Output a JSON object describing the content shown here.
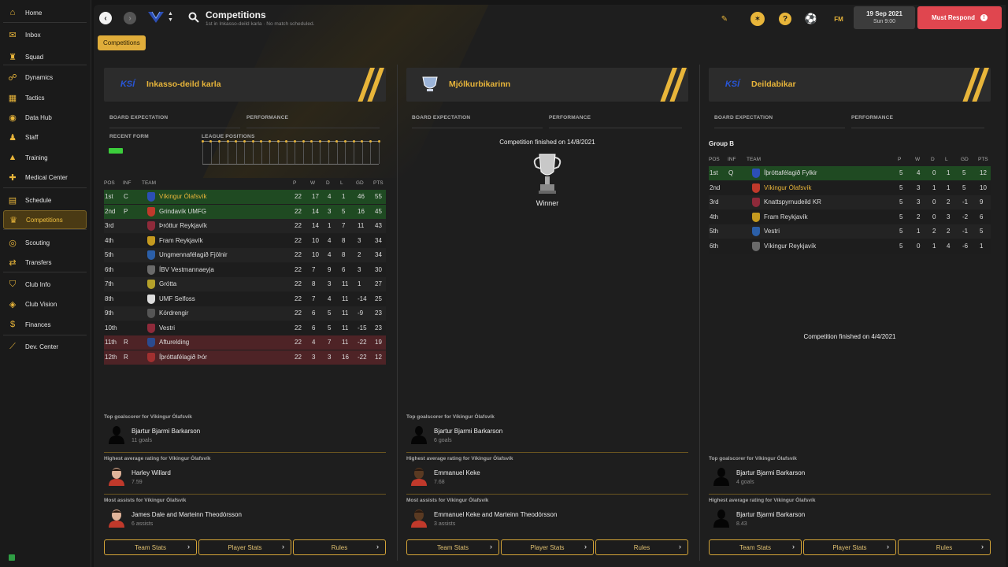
{
  "sidebar": {
    "items": [
      {
        "label": "Home",
        "icon": "home-icon",
        "glyph": "⌂"
      },
      {
        "label": "Inbox",
        "icon": "inbox-icon",
        "glyph": "✉"
      },
      {
        "label": "Squad",
        "icon": "shirt-icon",
        "glyph": "♜"
      },
      {
        "label": "Dynamics",
        "icon": "dynamics-icon",
        "glyph": "☍"
      },
      {
        "label": "Tactics",
        "icon": "tactics-icon",
        "glyph": "▦"
      },
      {
        "label": "Data Hub",
        "icon": "data-hub-icon",
        "glyph": "◉"
      },
      {
        "label": "Staff",
        "icon": "staff-icon",
        "glyph": "♟"
      },
      {
        "label": "Training",
        "icon": "training-icon",
        "glyph": "▲"
      },
      {
        "label": "Medical Center",
        "icon": "medical-icon",
        "glyph": "✚"
      },
      {
        "label": "Schedule",
        "icon": "schedule-icon",
        "glyph": "▤"
      },
      {
        "label": "Competitions",
        "icon": "trophy-icon",
        "glyph": "♛"
      },
      {
        "label": "Scouting",
        "icon": "scouting-icon",
        "glyph": "◎"
      },
      {
        "label": "Transfers",
        "icon": "transfers-icon",
        "glyph": "⇄"
      },
      {
        "label": "Club Info",
        "icon": "club-info-icon",
        "glyph": "⛉"
      },
      {
        "label": "Club Vision",
        "icon": "club-vision-icon",
        "glyph": "◈"
      },
      {
        "label": "Finances",
        "icon": "finances-icon",
        "glyph": "$"
      },
      {
        "label": "Dev. Center",
        "icon": "dev-center-icon",
        "glyph": "⟋"
      }
    ],
    "active_index": 10
  },
  "header": {
    "title": "Competitions",
    "subtitle": "1st in Inkasso-deild karla · No match scheduled.",
    "date": "19 Sep 2021",
    "time": "Sun 9:00",
    "fm_label": "FM",
    "must_respond": "Must Respond",
    "tag": "Competitions"
  },
  "panels": [
    {
      "name": "Inkasso-deild karla",
      "logo": "KSÍ",
      "board_expectation_label": "BOARD EXPECTATION",
      "performance_label": "PERFORMANCE",
      "recent_form_label": "RECENT FORM",
      "league_positions_label": "LEAGUE POSITIONS",
      "columns": [
        "POS",
        "INF",
        "TEAM",
        "P",
        "W",
        "D",
        "L",
        "GD",
        "PTS"
      ],
      "rows": [
        {
          "pos": "1st",
          "inf": "C",
          "team": "Víkingur Ólafsvík",
          "p": "22",
          "w": "17",
          "d": "4",
          "l": "1",
          "gd": "46",
          "pts": "55",
          "zone": "promo",
          "highlight": true
        },
        {
          "pos": "2nd",
          "inf": "P",
          "team": "Grindavík UMFG",
          "p": "22",
          "w": "14",
          "d": "3",
          "l": "5",
          "gd": "16",
          "pts": "45",
          "zone": "promo"
        },
        {
          "pos": "3rd",
          "inf": "",
          "team": "Þróttur Reykjavík",
          "p": "22",
          "w": "14",
          "d": "1",
          "l": "7",
          "gd": "11",
          "pts": "43"
        },
        {
          "pos": "4th",
          "inf": "",
          "team": "Fram Reykjavík",
          "p": "22",
          "w": "10",
          "d": "4",
          "l": "8",
          "gd": "3",
          "pts": "34"
        },
        {
          "pos": "5th",
          "inf": "",
          "team": "Ungmennafélagið Fjölnir",
          "p": "22",
          "w": "10",
          "d": "4",
          "l": "8",
          "gd": "2",
          "pts": "34"
        },
        {
          "pos": "6th",
          "inf": "",
          "team": "ÍBV Vestmannaeyja",
          "p": "22",
          "w": "7",
          "d": "9",
          "l": "6",
          "gd": "3",
          "pts": "30"
        },
        {
          "pos": "7th",
          "inf": "",
          "team": "Grótta",
          "p": "22",
          "w": "8",
          "d": "3",
          "l": "11",
          "gd": "1",
          "pts": "27"
        },
        {
          "pos": "8th",
          "inf": "",
          "team": "UMF Selfoss",
          "p": "22",
          "w": "7",
          "d": "4",
          "l": "11",
          "gd": "-14",
          "pts": "25"
        },
        {
          "pos": "9th",
          "inf": "",
          "team": "Kórdrengir",
          "p": "22",
          "w": "6",
          "d": "5",
          "l": "11",
          "gd": "-9",
          "pts": "23"
        },
        {
          "pos": "10th",
          "inf": "",
          "team": "Vestri",
          "p": "22",
          "w": "6",
          "d": "5",
          "l": "11",
          "gd": "-15",
          "pts": "23"
        },
        {
          "pos": "11th",
          "inf": "R",
          "team": "Afturelding",
          "p": "22",
          "w": "4",
          "d": "7",
          "l": "11",
          "gd": "-22",
          "pts": "19",
          "zone": "releg"
        },
        {
          "pos": "12th",
          "inf": "R",
          "team": "Íþróttafélagið Þór",
          "p": "22",
          "w": "3",
          "d": "3",
          "l": "16",
          "gd": "-22",
          "pts": "12",
          "zone": "releg"
        }
      ],
      "stats": [
        {
          "heading": "Top goalscorer for Víkingur Ólafsvík",
          "name": "Bjartur Bjarmi Barkarson",
          "value": "11 goals",
          "avatar": "silhouette"
        },
        {
          "heading": "Highest average rating for Víkingur Ólafsvík",
          "name": "Harley Willard",
          "value": "7.59",
          "avatar": "face-light"
        },
        {
          "heading": "Most assists for Víkingur Ólafsvík",
          "name": "James Dale and Marteinn Theodórsson",
          "value": "6 assists",
          "avatar": "face-light"
        }
      ],
      "buttons": [
        "Team Stats",
        "Player Stats",
        "Rules"
      ]
    },
    {
      "name": "Mjólkurbikarinn",
      "logo": "cup",
      "board_expectation_label": "BOARD EXPECTATION",
      "performance_label": "PERFORMANCE",
      "finished_text": "Competition finished on 14/8/2021",
      "winner_label": "Winner",
      "stats": [
        {
          "heading": "Top goalscorer for Víkingur Ólafsvík",
          "name": "Bjartur Bjarmi Barkarson",
          "value": "6 goals",
          "avatar": "silhouette"
        },
        {
          "heading": "Highest average rating for Víkingur Ólafsvík",
          "name": "Emmanuel Keke",
          "value": "7.68",
          "avatar": "face-dark"
        },
        {
          "heading": "Most assists for Víkingur Ólafsvík",
          "name": "Emmanuel Keke and Marteinn Theodórsson",
          "value": "3 assists",
          "avatar": "face-dark"
        }
      ],
      "buttons": [
        "Team Stats",
        "Player Stats",
        "Rules"
      ]
    },
    {
      "name": "Deildabikar",
      "logo": "KSÍ",
      "board_expectation_label": "BOARD EXPECTATION",
      "performance_label": "PERFORMANCE",
      "group_label": "Group B",
      "columns": [
        "POS",
        "INF",
        "TEAM",
        "P",
        "W",
        "D",
        "L",
        "GD",
        "PTS"
      ],
      "rows": [
        {
          "pos": "1st",
          "inf": "Q",
          "team": "Íþróttafélagið Fylkir",
          "p": "5",
          "w": "4",
          "d": "0",
          "l": "1",
          "gd": "5",
          "pts": "12",
          "zone": "promo"
        },
        {
          "pos": "2nd",
          "inf": "",
          "team": "Víkingur Ólafsvík",
          "p": "5",
          "w": "3",
          "d": "1",
          "l": "1",
          "gd": "5",
          "pts": "10",
          "highlight": true
        },
        {
          "pos": "3rd",
          "inf": "",
          "team": "Knattspyrnudeild KR",
          "p": "5",
          "w": "3",
          "d": "0",
          "l": "2",
          "gd": "-1",
          "pts": "9"
        },
        {
          "pos": "4th",
          "inf": "",
          "team": "Fram Reykjavík",
          "p": "5",
          "w": "2",
          "d": "0",
          "l": "3",
          "gd": "-2",
          "pts": "6"
        },
        {
          "pos": "5th",
          "inf": "",
          "team": "Vestri",
          "p": "5",
          "w": "1",
          "d": "2",
          "l": "2",
          "gd": "-1",
          "pts": "5"
        },
        {
          "pos": "6th",
          "inf": "",
          "team": "Víkingur Reykjavík",
          "p": "5",
          "w": "0",
          "d": "1",
          "l": "4",
          "gd": "-6",
          "pts": "1"
        }
      ],
      "finished_text": "Competition finished on 4/4/2021",
      "stats": [
        {
          "heading": "Top goalscorer for Víkingur Ólafsvík",
          "name": "Bjartur Bjarmi Barkarson",
          "value": "4 goals",
          "avatar": "silhouette"
        },
        {
          "heading": "Highest average rating for Víkingur Ólafsvík",
          "name": "Bjartur Bjarmi Barkarson",
          "value": "8.43",
          "avatar": "silhouette"
        }
      ],
      "buttons": [
        "Team Stats",
        "Player Stats",
        "Rules"
      ]
    }
  ],
  "colors": {
    "accent": "#e8b53a",
    "promo": "#1f4a22",
    "releg": "#4e2326",
    "must_respond": "#e0464f",
    "highlight_text": "#e8b53a"
  }
}
